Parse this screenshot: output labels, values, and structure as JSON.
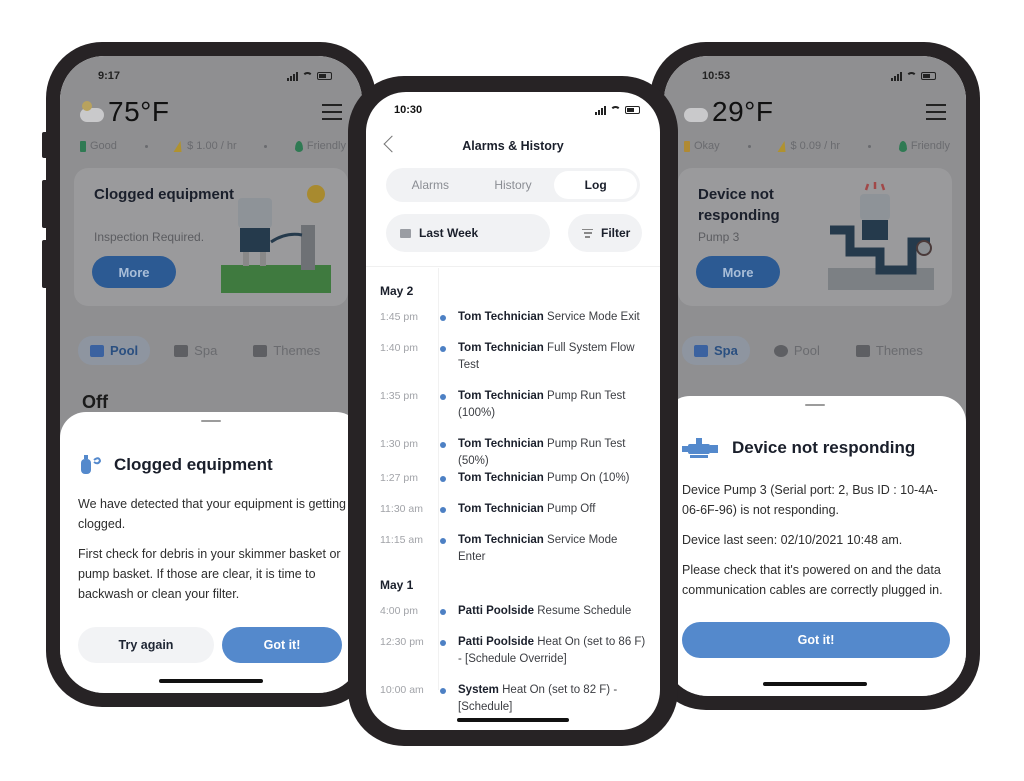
{
  "left_phone": {
    "status": {
      "time": "9:17"
    },
    "weather": {
      "temperature": "75°F",
      "icon": "partly-cloudy-icon"
    },
    "meta": [
      {
        "icon": "battery-icon",
        "label": "Good",
        "color": "#2f7a53"
      },
      {
        "icon": "bolt-icon",
        "label": "$ 1.00 / hr",
        "color": "#b0922f"
      },
      {
        "icon": "leaf-icon",
        "label": "Friendly",
        "color": "#2f7a53"
      }
    ],
    "alert_card": {
      "title": "Clogged equipment",
      "subtitle": "Inspection Required.",
      "button": "More"
    },
    "modes": [
      {
        "label": "Pool",
        "active": true
      },
      {
        "label": "Spa",
        "active": false
      },
      {
        "label": "Themes",
        "active": false
      }
    ],
    "state": "Off",
    "sheet": {
      "title": "Clogged equipment",
      "body1": "We have detected that your equipment is getting clogged.",
      "body2": "First check for debris in your skimmer basket or pump basket. If those are clear, it is time to backwash or clean your filter.",
      "secondary_button": "Try again",
      "primary_button": "Got it!"
    }
  },
  "center_phone": {
    "status": {
      "time": "10:30"
    },
    "title": "Alarms & History",
    "tabs": [
      {
        "label": "Alarms",
        "active": false
      },
      {
        "label": "History",
        "active": false
      },
      {
        "label": "Log",
        "active": true
      }
    ],
    "range_selector": "Last Week",
    "filter_button": "Filter",
    "log": [
      {
        "day": "May 2",
        "entries": [
          {
            "time": "1:45 pm",
            "actor": "Tom Technician",
            "action": "Service Mode Exit"
          },
          {
            "time": "1:40 pm",
            "actor": "Tom Technician",
            "action": "Full System Flow Test"
          },
          {
            "time": "1:35 pm",
            "actor": "Tom Technician",
            "action": "Pump Run Test (100%)"
          },
          {
            "time": "1:30 pm",
            "actor": "Tom Technician",
            "action": "Pump Run Test (50%)"
          },
          {
            "time": "1:27 pm",
            "actor": "Tom Technician",
            "action": "Pump On (10%)"
          },
          {
            "time": "11:30 am",
            "actor": "Tom Technician",
            "action": "Pump Off"
          },
          {
            "time": "11:15 am",
            "actor": "Tom Technician",
            "action": "Service Mode Enter"
          }
        ]
      },
      {
        "day": "May 1",
        "entries": [
          {
            "time": "4:00 pm",
            "actor": "Patti Poolside",
            "action": "Resume Schedule"
          },
          {
            "time": "12:30 pm",
            "actor": "Patti Poolside",
            "action": "Heat On (set to 86 F) - [Schedule Override]"
          },
          {
            "time": "10:00 am",
            "actor": "System",
            "action": "Heat On (set to 82 F) - [Schedule]"
          }
        ]
      }
    ],
    "accent": "#4d80c4"
  },
  "right_phone": {
    "status": {
      "time": "10:53"
    },
    "weather": {
      "temperature": "29°F",
      "icon": "cloudy-icon"
    },
    "meta": [
      {
        "icon": "battery-icon",
        "label": "Okay",
        "color": "#b08a33"
      },
      {
        "icon": "bolt-icon",
        "label": "$ 0.09 / hr",
        "color": "#b0922f"
      },
      {
        "icon": "leaf-icon",
        "label": "Friendly",
        "color": "#2f7a53"
      }
    ],
    "alert_card": {
      "title": "Device not responding",
      "subtitle": "Pump 3",
      "button": "More"
    },
    "modes": [
      {
        "label": "Spa",
        "active": true
      },
      {
        "label": "Pool",
        "active": false
      },
      {
        "label": "Themes",
        "active": false
      }
    ],
    "sheet": {
      "title": "Device not responding",
      "body1": "Device Pump 3 (Serial port: 2, Bus ID : 10-4A-06-6F-96) is not responding.",
      "body2": "Device last seen: 02/10/2021 10:48 am.",
      "body3": "Please check that it's powered on and the data communication cables are correctly plugged in.",
      "primary_button": "Got it!"
    }
  },
  "colors": {
    "primary_blue": "#5489cc",
    "dim_blue": "#2c5a93",
    "frame": "#272325"
  }
}
